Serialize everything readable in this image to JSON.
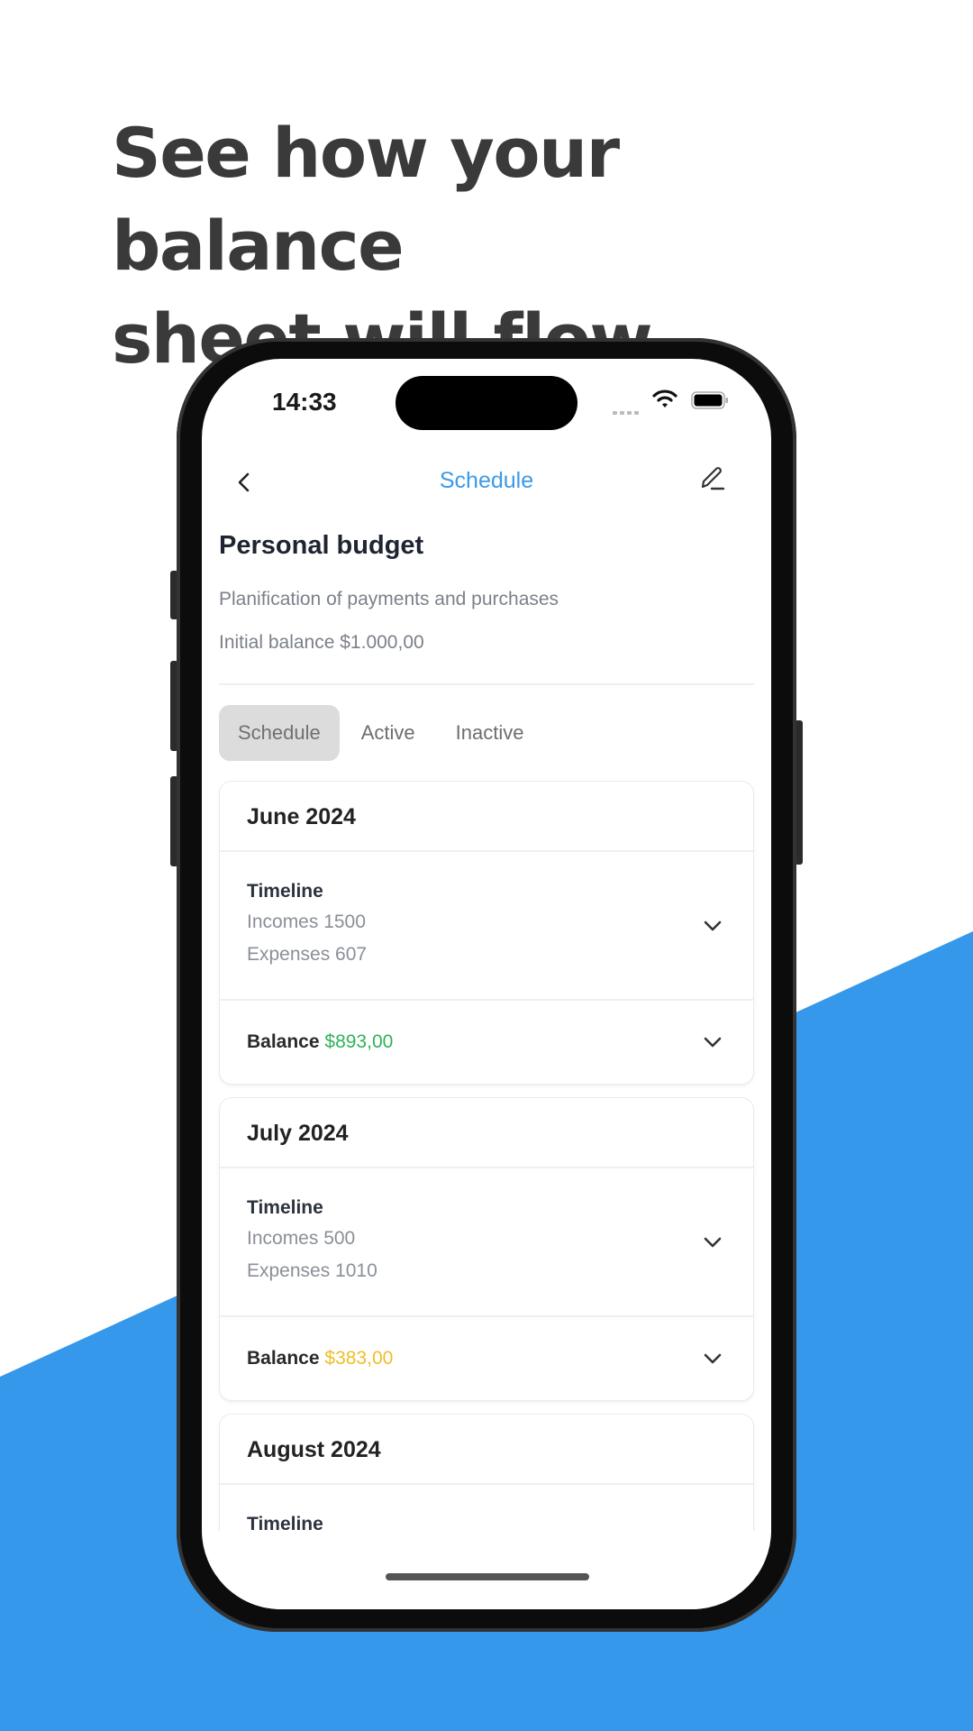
{
  "headline": {
    "line1": "See how your balance",
    "line2": "sheet will flow"
  },
  "colors": {
    "brand_blue": "#3598EA",
    "positive": "#2fb35a",
    "warning": "#f0bd2a",
    "nav_title": "#3b9ae8"
  },
  "status_bar": {
    "time": "14:33",
    "icons": [
      "cellular-signal-icon",
      "wifi-icon",
      "battery-icon"
    ]
  },
  "navbar": {
    "back_icon": "chevron-left-icon",
    "title": "Schedule",
    "edit_icon": "pencil-icon"
  },
  "budget": {
    "title": "Personal budget",
    "subtitle": "Planification of payments and purchases",
    "initial_balance": "Initial balance $1.000,00"
  },
  "tabs": [
    {
      "label": "Schedule",
      "active": true
    },
    {
      "label": "Active",
      "active": false
    },
    {
      "label": "Inactive",
      "active": false
    }
  ],
  "months": [
    {
      "title": "June 2024",
      "timeline_label": "Timeline",
      "incomes": "Incomes 1500",
      "expenses": "Expenses 607",
      "balance_label": "Balance",
      "balance_value": "$893,00",
      "balance_status": "positive"
    },
    {
      "title": "July 2024",
      "timeline_label": "Timeline",
      "incomes": "Incomes 500",
      "expenses": "Expenses 1010",
      "balance_label": "Balance",
      "balance_value": "$383,00",
      "balance_status": "warning"
    },
    {
      "title": "August 2024",
      "timeline_label": "Timeline"
    }
  ]
}
